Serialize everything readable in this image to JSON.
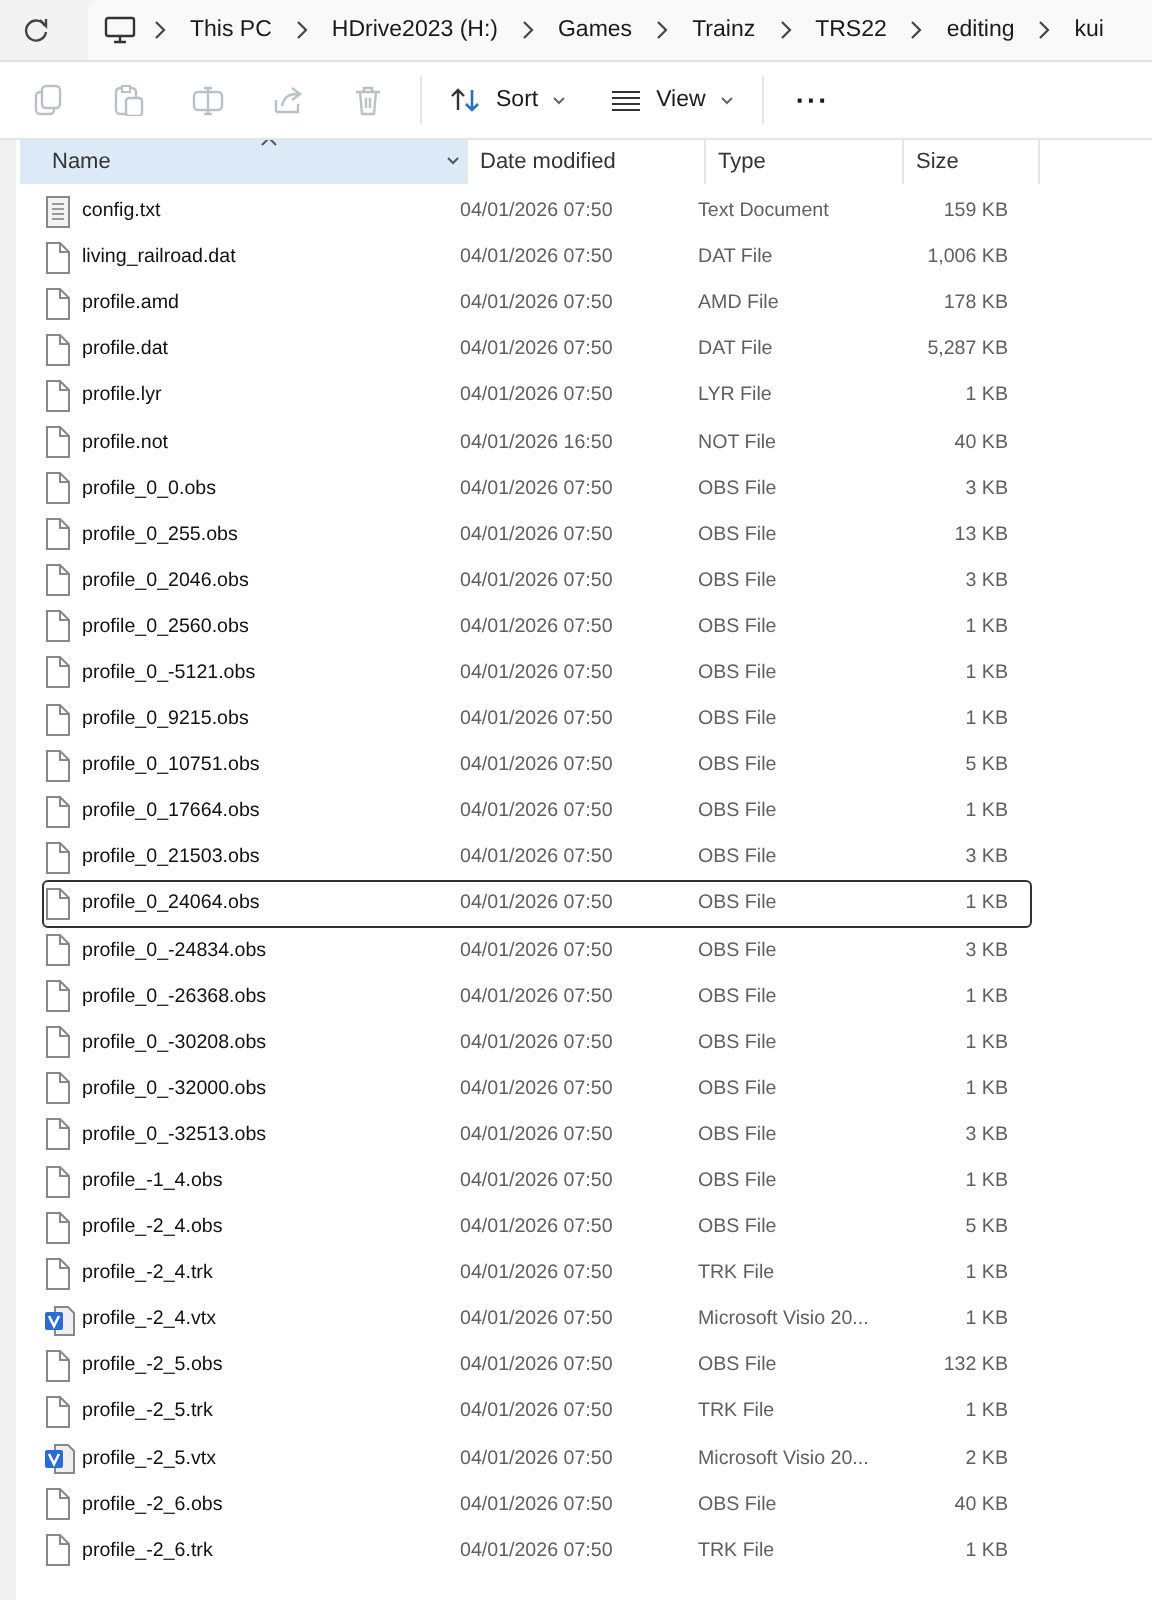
{
  "address_bar": {
    "crumbs": [
      "This PC",
      "HDrive2023 (H:)",
      "Games",
      "Trainz",
      "TRS22",
      "editing",
      "kui"
    ]
  },
  "toolbar": {
    "icon_buttons": [
      {
        "kind": "copy",
        "disabled": true
      },
      {
        "kind": "paste",
        "disabled": true
      },
      {
        "kind": "rename",
        "disabled": true
      },
      {
        "kind": "share",
        "disabled": true
      },
      {
        "kind": "delete",
        "disabled": true
      }
    ],
    "sort": {
      "label": "Sort"
    },
    "view": {
      "label": "View"
    },
    "more": {
      "label": "···"
    }
  },
  "columns": [
    {
      "label": "Name",
      "sorted": true
    },
    {
      "label": "Date modified",
      "sorted": false
    },
    {
      "label": "Type",
      "sorted": false
    },
    {
      "label": "Size",
      "sorted": false
    }
  ],
  "rows": [
    {
      "kind": "text",
      "name": "config.txt",
      "date": "04/01/2026 07:50",
      "type": "Text Document",
      "size": "159 KB",
      "focused": false
    },
    {
      "kind": "file",
      "name": "living_railroad.dat",
      "date": "04/01/2026 07:50",
      "type": "DAT File",
      "size": "1,006 KB",
      "focused": false
    },
    {
      "kind": "file",
      "name": "profile.amd",
      "date": "04/01/2026 07:50",
      "type": "AMD File",
      "size": "178 KB",
      "focused": false
    },
    {
      "kind": "file",
      "name": "profile.dat",
      "date": "04/01/2026 07:50",
      "type": "DAT File",
      "size": "5,287 KB",
      "focused": false
    },
    {
      "kind": "file",
      "name": "profile.lyr",
      "date": "04/01/2026 07:50",
      "type": "LYR File",
      "size": "1 KB",
      "focused": false
    },
    {
      "kind": "file",
      "name": "profile.not",
      "date": "04/01/2026 16:50",
      "type": "NOT File",
      "size": "40 KB",
      "focused": false
    },
    {
      "kind": "file",
      "name": "profile_0_0.obs",
      "date": "04/01/2026 07:50",
      "type": "OBS File",
      "size": "3 KB",
      "focused": false
    },
    {
      "kind": "file",
      "name": "profile_0_255.obs",
      "date": "04/01/2026 07:50",
      "type": "OBS File",
      "size": "13 KB",
      "focused": false
    },
    {
      "kind": "file",
      "name": "profile_0_2046.obs",
      "date": "04/01/2026 07:50",
      "type": "OBS File",
      "size": "3 KB",
      "focused": false
    },
    {
      "kind": "file",
      "name": "profile_0_2560.obs",
      "date": "04/01/2026 07:50",
      "type": "OBS File",
      "size": "1 KB",
      "focused": false
    },
    {
      "kind": "file",
      "name": "profile_0_-5121.obs",
      "date": "04/01/2026 07:50",
      "type": "OBS File",
      "size": "1 KB",
      "focused": false
    },
    {
      "kind": "file",
      "name": "profile_0_9215.obs",
      "date": "04/01/2026 07:50",
      "type": "OBS File",
      "size": "1 KB",
      "focused": false
    },
    {
      "kind": "file",
      "name": "profile_0_10751.obs",
      "date": "04/01/2026 07:50",
      "type": "OBS File",
      "size": "5 KB",
      "focused": false
    },
    {
      "kind": "file",
      "name": "profile_0_17664.obs",
      "date": "04/01/2026 07:50",
      "type": "OBS File",
      "size": "1 KB",
      "focused": false
    },
    {
      "kind": "file",
      "name": "profile_0_21503.obs",
      "date": "04/01/2026 07:50",
      "type": "OBS File",
      "size": "3 KB",
      "focused": false
    },
    {
      "kind": "file",
      "name": "profile_0_24064.obs",
      "date": "04/01/2026 07:50",
      "type": "OBS File",
      "size": "1 KB",
      "focused": true
    },
    {
      "kind": "file",
      "name": "profile_0_-24834.obs",
      "date": "04/01/2026 07:50",
      "type": "OBS File",
      "size": "3 KB",
      "focused": false
    },
    {
      "kind": "file",
      "name": "profile_0_-26368.obs",
      "date": "04/01/2026 07:50",
      "type": "OBS File",
      "size": "1 KB",
      "focused": false
    },
    {
      "kind": "file",
      "name": "profile_0_-30208.obs",
      "date": "04/01/2026 07:50",
      "type": "OBS File",
      "size": "1 KB",
      "focused": false
    },
    {
      "kind": "file",
      "name": "profile_0_-32000.obs",
      "date": "04/01/2026 07:50",
      "type": "OBS File",
      "size": "1 KB",
      "focused": false
    },
    {
      "kind": "file",
      "name": "profile_0_-32513.obs",
      "date": "04/01/2026 07:50",
      "type": "OBS File",
      "size": "3 KB",
      "focused": false
    },
    {
      "kind": "file",
      "name": "profile_-1_4.obs",
      "date": "04/01/2026 07:50",
      "type": "OBS File",
      "size": "1 KB",
      "focused": false
    },
    {
      "kind": "file",
      "name": "profile_-2_4.obs",
      "date": "04/01/2026 07:50",
      "type": "OBS File",
      "size": "5 KB",
      "focused": false
    },
    {
      "kind": "file",
      "name": "profile_-2_4.trk",
      "date": "04/01/2026 07:50",
      "type": "TRK File",
      "size": "1 KB",
      "focused": false
    },
    {
      "kind": "visio",
      "name": "profile_-2_4.vtx",
      "date": "04/01/2026 07:50",
      "type": "Microsoft Visio 20...",
      "size": "1 KB",
      "focused": false
    },
    {
      "kind": "file",
      "name": "profile_-2_5.obs",
      "date": "04/01/2026 07:50",
      "type": "OBS File",
      "size": "132 KB",
      "focused": false
    },
    {
      "kind": "file",
      "name": "profile_-2_5.trk",
      "date": "04/01/2026 07:50",
      "type": "TRK File",
      "size": "1 KB",
      "focused": false
    },
    {
      "kind": "visio",
      "name": "profile_-2_5.vtx",
      "date": "04/01/2026 07:50",
      "type": "Microsoft Visio 20...",
      "size": "2 KB",
      "focused": false
    },
    {
      "kind": "file",
      "name": "profile_-2_6.obs",
      "date": "04/01/2026 07:50",
      "type": "OBS File",
      "size": "40 KB",
      "focused": false
    },
    {
      "kind": "file",
      "name": "profile_-2_6.trk",
      "date": "04/01/2026 07:50",
      "type": "TRK File",
      "size": "1 KB",
      "focused": false
    }
  ]
}
